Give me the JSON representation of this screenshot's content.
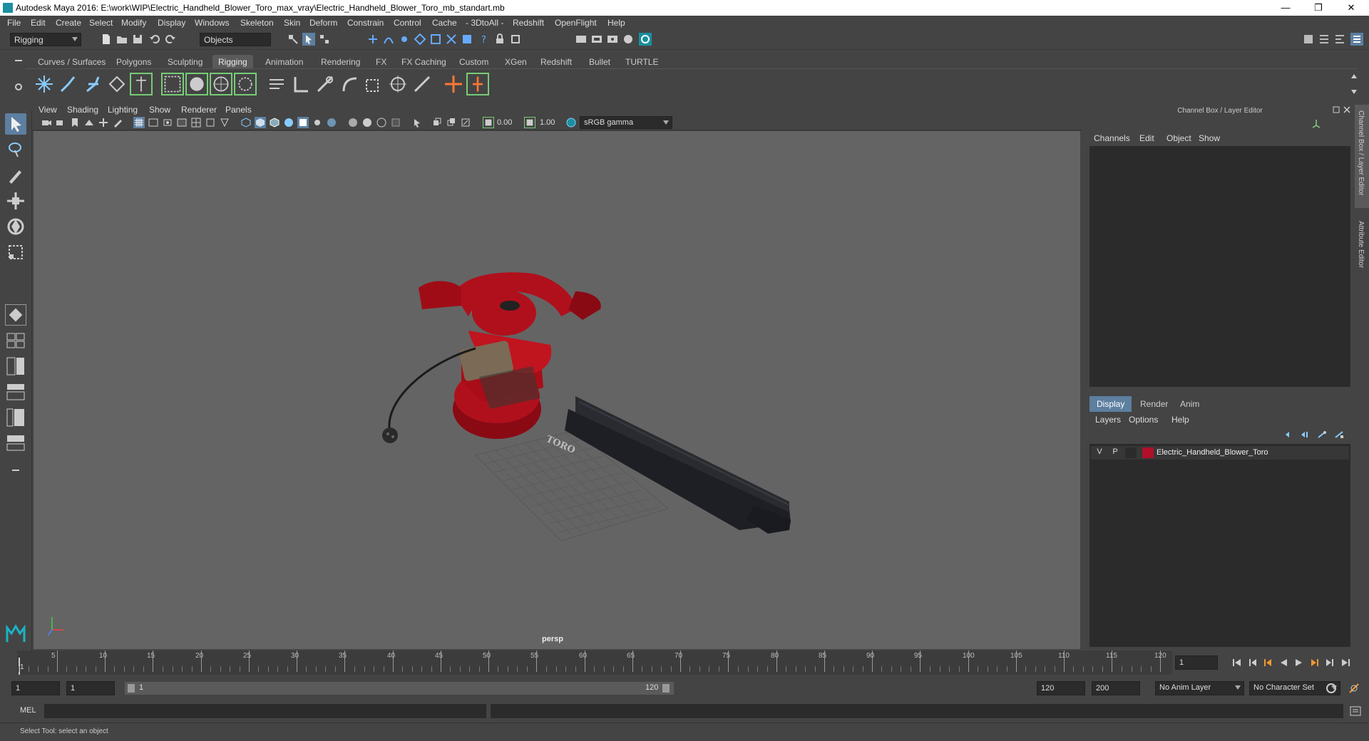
{
  "window": {
    "title": "Autodesk Maya 2016: E:\\work\\WIP\\Electric_Handheld_Blower_Toro_max_vray\\Electric_Handheld_Blower_Toro_mb_standart.mb"
  },
  "menus": [
    "File",
    "Edit",
    "Create",
    "Select",
    "Modify",
    "Display",
    "Windows",
    "Skeleton",
    "Skin",
    "Deform",
    "Constrain",
    "Control",
    "Cache",
    "- 3DtoAll -",
    "Redshift",
    "OpenFlight",
    "Help"
  ],
  "toolbar": {
    "mode": "Rigging",
    "selection_mask": "Objects"
  },
  "shelf_tabs": [
    "Curves / Surfaces",
    "Polygons",
    "Sculpting",
    "Rigging",
    "Animation",
    "Rendering",
    "FX",
    "FX Caching",
    "Custom",
    "XGen",
    "Redshift",
    "Bullet",
    "TURTLE"
  ],
  "active_shelf": "Rigging",
  "viewport": {
    "menus": [
      "View",
      "Shading",
      "Lighting",
      "Show",
      "Renderer",
      "Panels"
    ],
    "exposure": "0.00",
    "gamma": "1.00",
    "color_space": "sRGB gamma",
    "camera": "persp",
    "logo_text": "TORO"
  },
  "channel_box": {
    "title": "Channel Box / Layer Editor",
    "menus": [
      "Channels",
      "Edit",
      "Object",
      "Show"
    ]
  },
  "layer_editor": {
    "tabs": [
      "Display",
      "Render",
      "Anim"
    ],
    "active_tab": "Display",
    "menus": [
      "Layers",
      "Options",
      "Help"
    ],
    "layers": [
      {
        "v": "V",
        "p": "P",
        "name": "Electric_Handheld_Blower_Toro",
        "color": "#b0102a"
      }
    ]
  },
  "side_tabs": [
    "Channel Box / Layer Editor",
    "Attribute Editor"
  ],
  "timeline": {
    "ticks": [
      "5",
      "10",
      "15",
      "20",
      "25",
      "30",
      "35",
      "40",
      "45",
      "50",
      "55",
      "60",
      "65",
      "70",
      "75",
      "80",
      "85",
      "90",
      "95",
      "100",
      "105",
      "110",
      "115",
      "120"
    ],
    "start_label": "1",
    "current_frame": "1"
  },
  "range": {
    "start": "1",
    "playback_start": "1",
    "slider_start": "1",
    "slider_end": "120",
    "playback_end": "120",
    "end": "200",
    "anim_layer": "No Anim Layer",
    "character_set": "No Character Set"
  },
  "mel": {
    "label": "MEL"
  },
  "status": {
    "text": "Select Tool: select an object"
  },
  "colors": {
    "accent": "#5d7fa0",
    "blower_red": "#b0101c",
    "blower_dark": "#222428"
  }
}
